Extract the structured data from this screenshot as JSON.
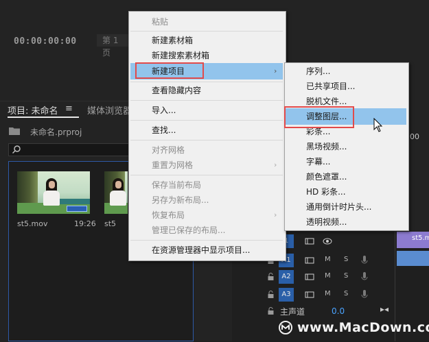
{
  "monitor": {
    "timecode": "00:00:00:00",
    "page_select": "第 1 页"
  },
  "project_panel": {
    "project_tab": "项目: 未命名",
    "menu_icon": "≡",
    "media_tab": "媒体浏览器",
    "project_file": "未命名.prproj",
    "clips": [
      {
        "name": "st5.mov",
        "duration": "19:26"
      },
      {
        "name": "st5",
        "duration": ""
      }
    ]
  },
  "timeline": {
    "ruler_label": "00",
    "clip_label": "st5.m",
    "tracks": [
      {
        "label": "1",
        "show_eye": true
      },
      {
        "label": "A1",
        "m": "M",
        "s": "S"
      },
      {
        "label": "A2",
        "m": "M",
        "s": "S"
      },
      {
        "label": "A3",
        "m": "M",
        "s": "S"
      }
    ],
    "master_label": "主声道",
    "master_value": "0.0",
    "master_arrow": "▸◂"
  },
  "context_menu": {
    "items": [
      {
        "label": "粘贴",
        "enabled": false
      },
      {
        "label": "新建素材箱",
        "enabled": true
      },
      {
        "label": "新建搜索素材箱",
        "enabled": true
      },
      {
        "label": "新建项目",
        "enabled": true,
        "submenu": true,
        "highlighted": true
      },
      {
        "label": "查看隐藏内容",
        "enabled": true
      },
      {
        "label": "导入...",
        "enabled": true
      },
      {
        "label": "查找...",
        "enabled": true
      },
      {
        "label": "对齐网格",
        "enabled": false
      },
      {
        "label": "重置为网格",
        "enabled": false,
        "submenu": true
      },
      {
        "label": "保存当前布局",
        "enabled": false
      },
      {
        "label": "另存为新布局...",
        "enabled": false
      },
      {
        "label": "恢复布局",
        "enabled": false,
        "submenu": true
      },
      {
        "label": "管理已保存的布局...",
        "enabled": false
      },
      {
        "label": "在资源管理器中显示项目...",
        "enabled": true
      }
    ]
  },
  "submenu": {
    "items": [
      {
        "label": "序列..."
      },
      {
        "label": "已共享项目..."
      },
      {
        "label": "脱机文件..."
      },
      {
        "label": "调整图层...",
        "highlighted": true
      },
      {
        "label": "彩条..."
      },
      {
        "label": "黑场视频..."
      },
      {
        "label": "字幕..."
      },
      {
        "label": "颜色遮罩..."
      },
      {
        "label": "HD 彩条..."
      },
      {
        "label": "通用倒计时片头..."
      },
      {
        "label": "透明视频..."
      }
    ]
  },
  "watermark": {
    "text": "www.MacDown.com"
  },
  "colors": {
    "menu_bg": "#f0f0f0",
    "menu_highlight": "#92c4ec",
    "annotation_red": "#e24a4a",
    "track_blue": "#2a5fa8",
    "value_blue": "#4aa3ff"
  }
}
